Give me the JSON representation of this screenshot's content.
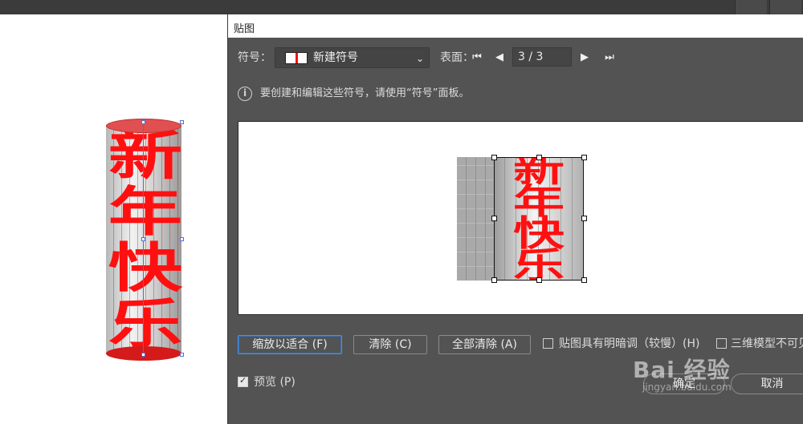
{
  "dialog": {
    "title": "贴图",
    "symbol_label": "符号：",
    "symbol_value": "新建符号",
    "surface_label": "表面：",
    "page_value": "3 / 3",
    "info_text": "要创建和编辑这些符号，请使用“符号”面板。",
    "buttons": {
      "scale_to_fit": "缩放以适合 (F)",
      "clear": "清除 (C)",
      "clear_all": "全部清除 (A)",
      "ok": "确定",
      "cancel": "取消"
    },
    "shade_artwork": {
      "label": "贴图具有明暗调（较慢）(H)",
      "checked": false
    },
    "invisible_geometry": {
      "label": "三维模型不可见",
      "checked": false
    },
    "preview": {
      "label": "预览 (P)",
      "checked": true
    }
  },
  "artwork": {
    "text_chars": [
      "新",
      "年",
      "快",
      "乐"
    ],
    "color": "#ff1010"
  },
  "watermark": {
    "brand": "Bai  经验",
    "url": "jingyan.baidu.com"
  }
}
